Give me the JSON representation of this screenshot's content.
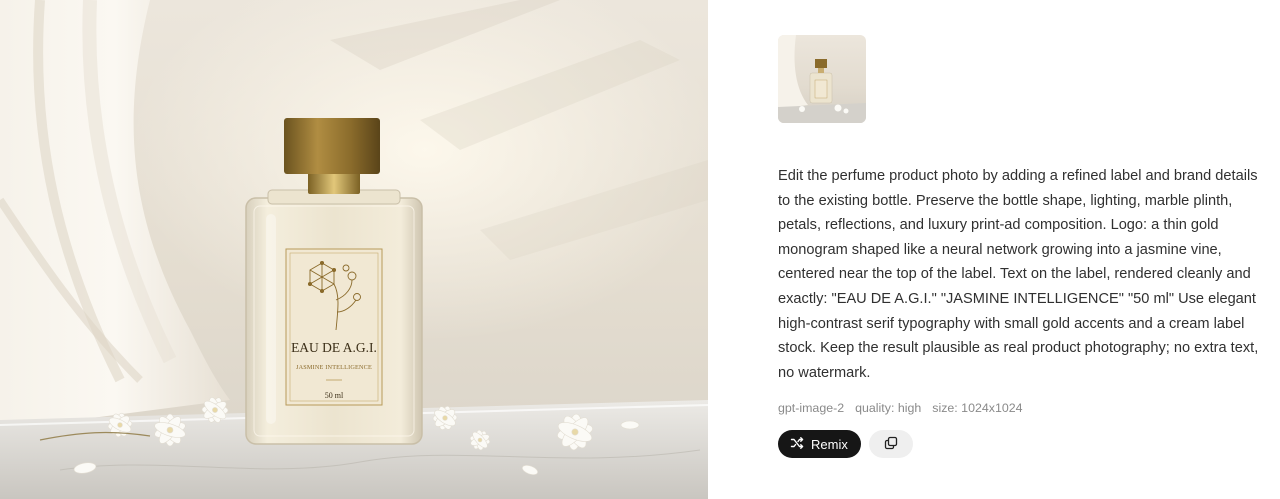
{
  "image": {
    "label_brand": "EAU DE A.G.I.",
    "label_subtitle": "JASMINE INTELLIGENCE",
    "label_volume": "50 ml"
  },
  "prompt": "Edit the perfume product photo by adding a refined label and brand details to the existing bottle. Preserve the bottle shape, lighting, marble plinth, petals, reflections, and luxury print-ad composition. Logo: a thin gold monogram shaped like a neural network growing into a jasmine vine, centered near the top of the label. Text on the label, rendered cleanly and exactly: \"EAU DE A.G.I.\" \"JASMINE INTELLIGENCE\" \"50 ml\" Use elegant high-contrast serif typography with small gold accents and a cream label stock. Keep the result plausible as real product photography; no extra text, no watermark.",
  "meta": {
    "model": "gpt-image-2",
    "quality": "quality: high",
    "size": "size: 1024x1024"
  },
  "actions": {
    "remix_label": "Remix",
    "remix_icon": "shuffle-icon",
    "copy_icon": "copy-icon"
  },
  "colors": {
    "gold": "#8a6a2a",
    "label_cream": "#f1e8d3",
    "button_dark": "#161616"
  }
}
